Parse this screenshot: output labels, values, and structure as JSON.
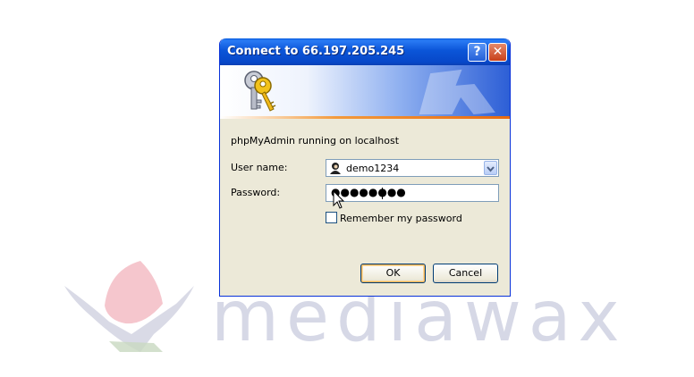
{
  "dialog": {
    "title": "Connect to 66.197.205.245",
    "help_glyph": "?",
    "close_glyph": "✕",
    "realm_text": "phpMyAdmin running on localhost",
    "username_label": "User name:",
    "username_value": "demo1234",
    "password_label": "Password:",
    "password_masked": "●●●●●●●●",
    "remember_label": "Remember my password",
    "remember_checked": false,
    "ok_label": "OK",
    "cancel_label": "Cancel"
  },
  "icons": {
    "banner": "keys-icon",
    "username": "user-icon",
    "dropdown": "chevron-down-icon",
    "pointer": "mouse-cursor-icon"
  },
  "watermark": {
    "text": "mediawax"
  },
  "colors": {
    "titlebar": "#0b55d8",
    "dialog_bg": "#ece9d8",
    "watermark_text": "#d6d8e6",
    "watermark_red": "#f3b8c0"
  }
}
